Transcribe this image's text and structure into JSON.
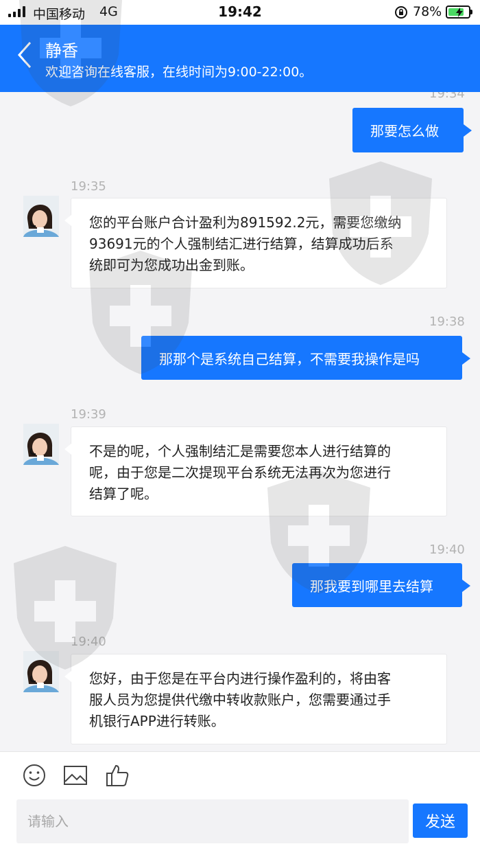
{
  "status_bar": {
    "carrier": "中国移动",
    "network": "4G",
    "time": "19:42",
    "battery_percent": "78%",
    "battery_level": 0.78
  },
  "header": {
    "back_icon": "chevron-left-icon",
    "agent_name": "静香",
    "subtitle": "欢迎咨询在线客服，在线时间为9:00-22:00。"
  },
  "messages": [
    {
      "direction": "out",
      "timestamp": "19:34",
      "text": "那要怎么做"
    },
    {
      "direction": "in",
      "timestamp": "19:35",
      "lines": [
        "您的平台账户合计盈利为891592.2元，需要您缴纳",
        "93691元的个人强制结汇进行结算，结算成功后系",
        "统即可为您成功出金到账。"
      ]
    },
    {
      "direction": "out",
      "timestamp": "19:38",
      "text": "那那个是系统自己结算，不需要我操作是吗"
    },
    {
      "direction": "in",
      "timestamp": "19:39",
      "lines": [
        "不是的呢，个人强制结汇是需要您本人进行结算的",
        "呢，由于您是二次提现平台系统无法再次为您进行",
        "结算了呢。"
      ]
    },
    {
      "direction": "out",
      "timestamp": "19:40",
      "text": "那我要到哪里去结算"
    },
    {
      "direction": "in",
      "timestamp": "19:40",
      "lines": [
        "您好，由于您是在平台内进行操作盈利的，将由客",
        "服人员为您提供代缴中转收款账户，您需要通过手",
        "机银行APP进行转账。"
      ]
    }
  ],
  "toolbar": {
    "icons": [
      "smiley-icon",
      "image-icon",
      "thumbs-up-icon"
    ]
  },
  "composer": {
    "placeholder": "请输入",
    "value": "",
    "send_label": "发送"
  },
  "colors": {
    "accent": "#1677ff",
    "background": "#f4f4f6",
    "timestamp": "#b3b3b3"
  }
}
